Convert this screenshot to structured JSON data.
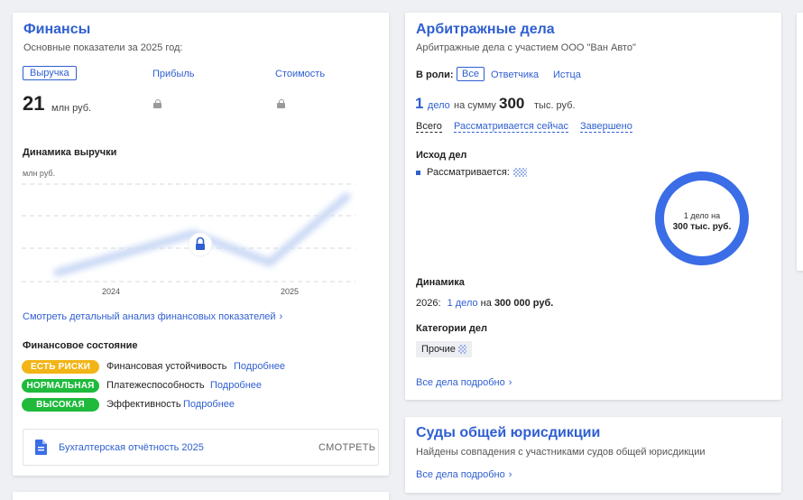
{
  "finance": {
    "title": "Финансы",
    "subtitle": "Основные показатели за 2025 год:",
    "tabs": [
      {
        "label": "Выручка"
      },
      {
        "label": "Прибыль"
      },
      {
        "label": "Стоимость"
      }
    ],
    "revenue_value": "21",
    "revenue_unit": "млн руб.",
    "chart_title": "Динамика выручки",
    "chart_unit": "млн руб.",
    "chart_data": {
      "type": "line",
      "categories": [
        "2024",
        "2025"
      ],
      "title": "Динамика выручки",
      "ylabel": "млн руб.",
      "values_locked": true
    },
    "details_link": "Смотреть детальный анализ финансовых показателей",
    "state_title": "Финансовое состояние",
    "states": [
      {
        "badge": "ЕСТЬ РИСКИ",
        "label": "Финансовая устойчивость",
        "link": "Подробнее",
        "color": "#f2b416"
      },
      {
        "badge": "НОРМАЛЬНАЯ",
        "label": "Платежеспособность",
        "link": "Подробнее",
        "color": "#1fba3c"
      },
      {
        "badge": "ВЫСОКАЯ",
        "label": "Эффективность",
        "link": "Подробнее",
        "color": "#1fba3c"
      }
    ],
    "report_label": "Бухгалтерская отчётность 2025",
    "report_action": "СМОТРЕТЬ"
  },
  "arbitration": {
    "title": "Арбитражные дела",
    "subtitle": "Арбитражные дела с участием ООО \"Ван Авто\"",
    "role_label": "В роли:",
    "roles": [
      {
        "label": "Все"
      },
      {
        "label": "Ответчика"
      },
      {
        "label": "Истца"
      }
    ],
    "count_num": "1",
    "count_word": "дело",
    "sum_prefix": "на сумму",
    "sum_value": "300",
    "sum_unit": "тыс. руб.",
    "filters": [
      {
        "label": "Всего"
      },
      {
        "label": "Рассматривается сейчас"
      },
      {
        "label": "Завершено"
      }
    ],
    "outcome_title": "Исход дел",
    "outcome_item": "Рассматривается:",
    "donut_line1": "1 дело на",
    "donut_line2": "300 тыс. руб.",
    "dynamics_title": "Динамика",
    "dynamics_year": "2026:",
    "dynamics_link": "1 дело",
    "dynamics_on": "на",
    "dynamics_sum": "300 000 руб.",
    "categories_title": "Категории дел",
    "category_tag": "Прочие",
    "all_link": "Все дела подробно",
    "colors": {
      "accent": "#2f5fd0",
      "donut": "#3a6de6"
    }
  },
  "courts": {
    "title": "Суды общей юрисдикции",
    "subtitle": "Найдены совпадения с участниками судов общей юрисдикции",
    "all_link": "Все дела подробно"
  }
}
